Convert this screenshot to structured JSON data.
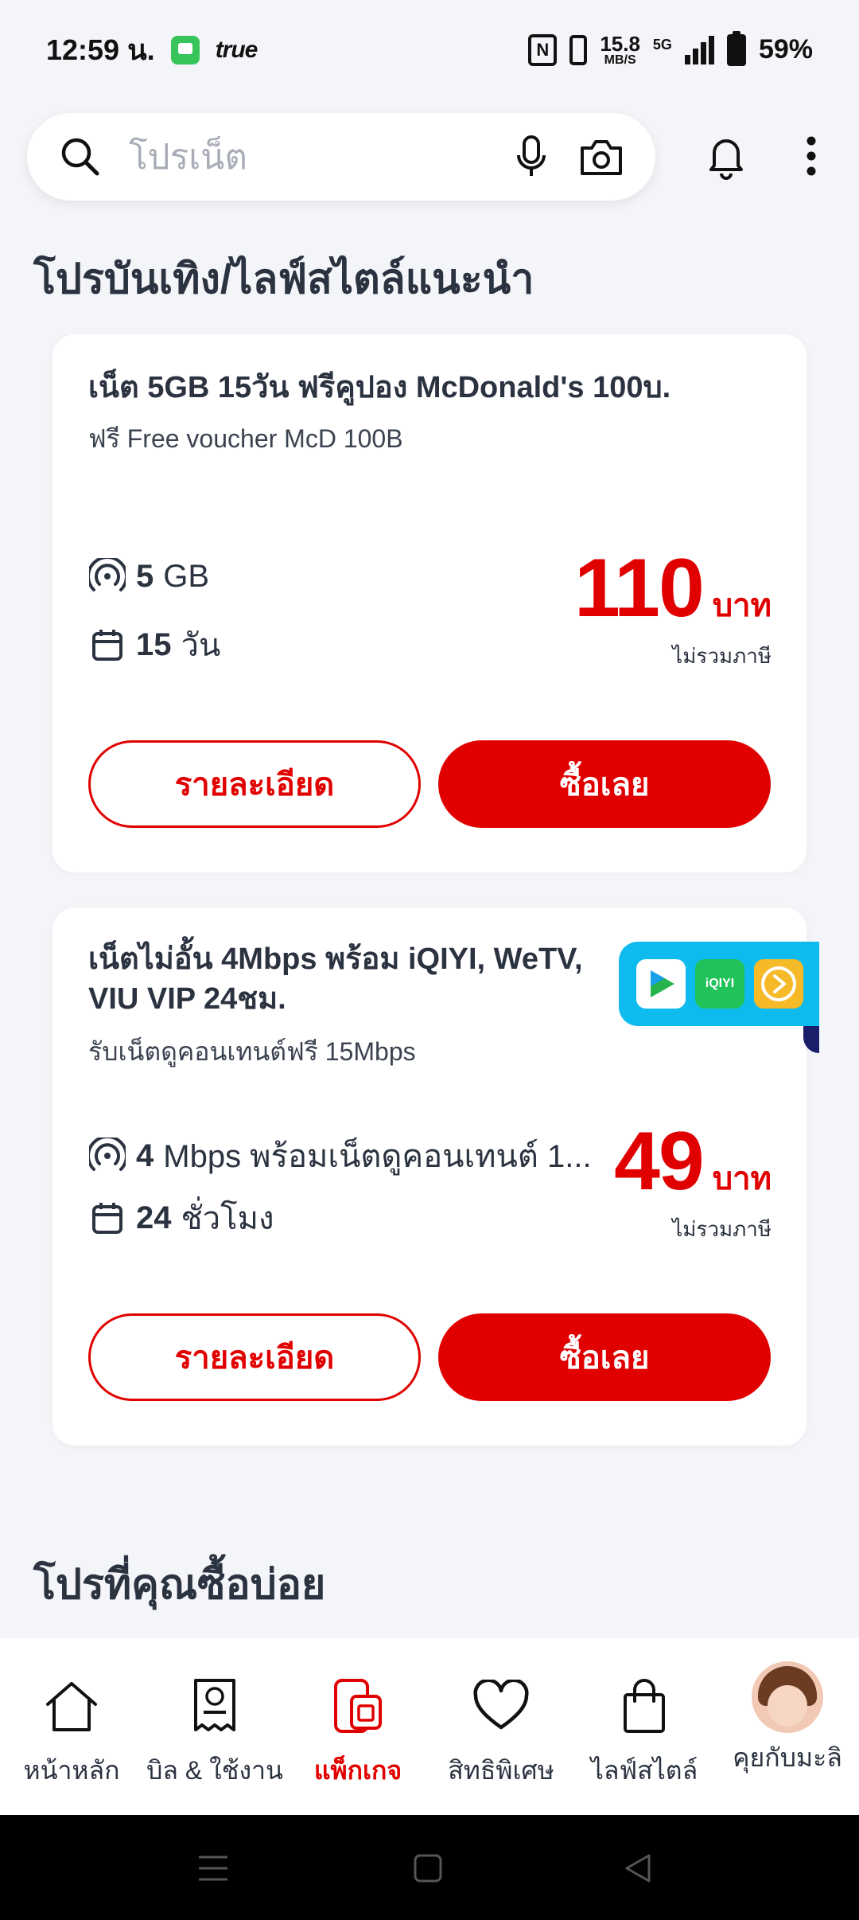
{
  "status_bar": {
    "time": "12:59 น.",
    "carrier_logo": "true",
    "net_speed_value": "15.8",
    "net_speed_unit": "MB/S",
    "network_type": "5G",
    "battery": "59%",
    "icons": [
      "message-app-icon",
      "nfc-icon",
      "vibrate-icon",
      "signal-icon",
      "battery-icon"
    ]
  },
  "search": {
    "placeholder": "โปรเน็ต",
    "icons": [
      "search-icon",
      "mic-icon",
      "camera-icon",
      "bell-icon",
      "more-vertical-icon"
    ]
  },
  "section_recommended": {
    "title": "โปรบันเทิง/ไลฟ์สไตล์แนะนำ"
  },
  "cards": [
    {
      "title": "เน็ต 5GB 15วัน ฟรีคูปอง McDonald's 100บ.",
      "subtitle": "ฟรี Free voucher McD 100B",
      "data_amount": "5",
      "data_unit": "GB",
      "duration_amount": "15",
      "duration_unit": "วัน",
      "price": "110",
      "currency": "บาท",
      "vat_note": "ไม่รวมภาษี",
      "details_label": "รายละเอียด",
      "buy_label": "ซื้อเลย"
    },
    {
      "title_line1": "เน็ตไม่อั้น 4Mbps พร้อม iQIYI, WeTV,",
      "title_line2": "VIU VIP 24ชม.",
      "subtitle": "รับเน็ตดูคอนเทนต์ฟรี 15Mbps",
      "data_amount": "4",
      "data_unit": "Mbps พร้อมเน็ตดูคอนเทนต์ 1...",
      "duration_amount": "24",
      "duration_unit": "ชั่วโมง",
      "price": "49",
      "currency": "บาท",
      "vat_note": "ไม่รวมภาษี",
      "details_label": "รายละเอียด",
      "buy_label": "ซื้อเลย",
      "partner_logos": [
        "wetv-logo",
        "iqiyi-logo",
        "viu-logo"
      ],
      "iqiyi_text": "iQIYI"
    }
  ],
  "section_frequent": {
    "title": "โปรที่คุณซื้อบ่อย"
  },
  "bottom_nav": {
    "items": [
      {
        "label": "หน้าหลัก",
        "icon": "home-icon"
      },
      {
        "label": "บิล & ใช้งาน",
        "icon": "bill-icon"
      },
      {
        "label": "แพ็กเกจ",
        "icon": "package-sim-icon",
        "active": true
      },
      {
        "label": "สิทธิพิเศษ",
        "icon": "heart-icon"
      },
      {
        "label": "ไลฟ์สไตล์",
        "icon": "shopping-bag-icon"
      },
      {
        "label": "คุยกับมะลิ",
        "icon": "mali-avatar"
      }
    ]
  },
  "colors": {
    "accent": "#e10000",
    "text": "#2b3240",
    "background": "#f4f5f8",
    "badge": "#0dbbee"
  }
}
